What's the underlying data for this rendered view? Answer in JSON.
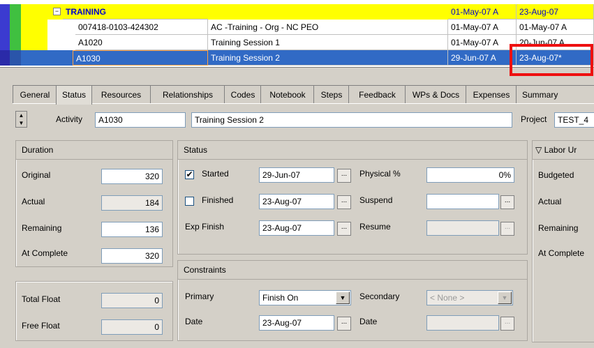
{
  "grid": {
    "rows": [
      {
        "id": "TRAINING",
        "name": "",
        "start": "01-May-07 A",
        "finish": "23-Aug-07",
        "type": "wbs"
      },
      {
        "id": "007418-0103-424302",
        "name": "AC -Training - Org - NC PEO",
        "start": "01-May-07 A",
        "finish": "01-May-07 A",
        "type": "activity"
      },
      {
        "id": "A1020",
        "name": "Training Session 1",
        "start": "01-May-07 A",
        "finish": "20-Jun-07 A",
        "type": "activity"
      },
      {
        "id": "A1030",
        "name": "Training Session 2",
        "start": "29-Jun-07 A",
        "finish": "23-Aug-07*",
        "type": "selected"
      }
    ],
    "expander": "−"
  },
  "tabs": [
    "General",
    "Status",
    "Resources",
    "Relationships",
    "Codes",
    "Notebook",
    "Steps",
    "Feedback",
    "WPs & Docs",
    "Expenses",
    "Summary"
  ],
  "activity": {
    "label": "Activity",
    "id": "A1030",
    "name": "Training Session 2",
    "project_label": "Project",
    "project": "TEST_4"
  },
  "duration": {
    "title": "Duration",
    "original_label": "Original",
    "original": "320",
    "actual_label": "Actual",
    "actual": "184",
    "remaining_label": "Remaining",
    "remaining": "136",
    "at_complete_label": "At Complete",
    "at_complete": "320"
  },
  "float": {
    "total_label": "Total Float",
    "total": "0",
    "free_label": "Free Float",
    "free": "0"
  },
  "status": {
    "title": "Status",
    "started_label": "Started",
    "started": "29-Jun-07",
    "finished_label": "Finished",
    "finished": "23-Aug-07",
    "exp_finish_label": "Exp Finish",
    "exp_finish": "23-Aug-07",
    "physical_label": "Physical %",
    "physical": "0%",
    "suspend_label": "Suspend",
    "suspend": "",
    "resume_label": "Resume",
    "resume": ""
  },
  "constraints": {
    "title": "Constraints",
    "primary_label": "Primary",
    "primary": "Finish On",
    "secondary_label": "Secondary",
    "secondary": "< None >",
    "date_label": "Date",
    "date": "23-Aug-07",
    "date2_label": "Date",
    "date2": ""
  },
  "labor": {
    "title": "Labor Ur",
    "budgeted_label": "Budgeted",
    "actual_label": "Actual",
    "remaining_label": "Remaining",
    "at_complete_label": "At Complete"
  },
  "ellipsis": "...",
  "colors": {
    "highlight": "#ee1010",
    "selection": "#316ac5",
    "wbs": "#ffff00",
    "wbs_text": "#0000cc"
  }
}
